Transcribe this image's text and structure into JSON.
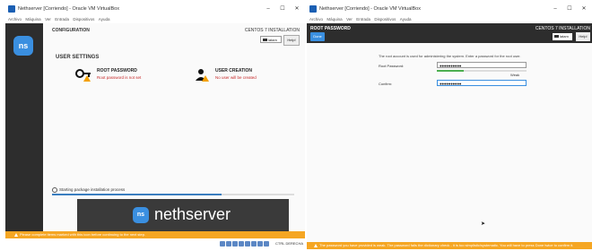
{
  "left_window": {
    "title": "Nethserver [Corriendo] - Oracle VM VirtualBox",
    "controls": [
      "–",
      "☐",
      "✕"
    ],
    "menu": [
      "Archivo",
      "Máquina",
      "Ver",
      "Entrada",
      "Dispositivos",
      "Ayuda"
    ],
    "installer": {
      "logo": "ns",
      "header": "CONFIGURATION",
      "header_right": "CENTOS 7 INSTALLATION",
      "keyboard": "latam",
      "help": "Help!",
      "section": "USER SETTINGS",
      "root_password": {
        "title": "ROOT PASSWORD",
        "warning": "Root password is not set"
      },
      "user_creation": {
        "title": "USER CREATION",
        "warning": "No user will be created"
      },
      "progress_text": "Starting package installation process",
      "progress": 0.7,
      "banner_word": "nethserver",
      "warning_bar": "Please complete items marked with this icon before continuing to the next step."
    },
    "status_host": "CTRL DERECHA"
  },
  "right_window": {
    "title": "Nethserver [Corriendo] - Oracle VM VirtualBox",
    "controls": [
      "–",
      "☐",
      "✕"
    ],
    "menu": [
      "Archivo",
      "Máquina",
      "Ver",
      "Entrada",
      "Dispositivos",
      "Ayuda"
    ],
    "installer": {
      "header": "ROOT PASSWORD",
      "header_right": "CENTOS 7 INSTALLATION",
      "done": "Done",
      "keyboard": "latam",
      "help": "Help!",
      "description": "The root account is used for administering the system. Enter a password for the root user.",
      "root_password_label": "Root Password:",
      "root_password_value": "●●●●●●●●●●",
      "strength": 0.3,
      "strength_word": "Weak",
      "confirm_label": "Confirm:",
      "confirm_value": "●●●●●●●●●●",
      "warning_bar": "The password you have provided is weak. The password fails the dictionary check - it is too simplistic/systematic. You will have to press Done twice to confirm it."
    }
  },
  "colors": {
    "accent": "#3a8fe0",
    "warning": "#f5a623",
    "error": "#c62828",
    "sidebar": "#2d2d2d"
  }
}
